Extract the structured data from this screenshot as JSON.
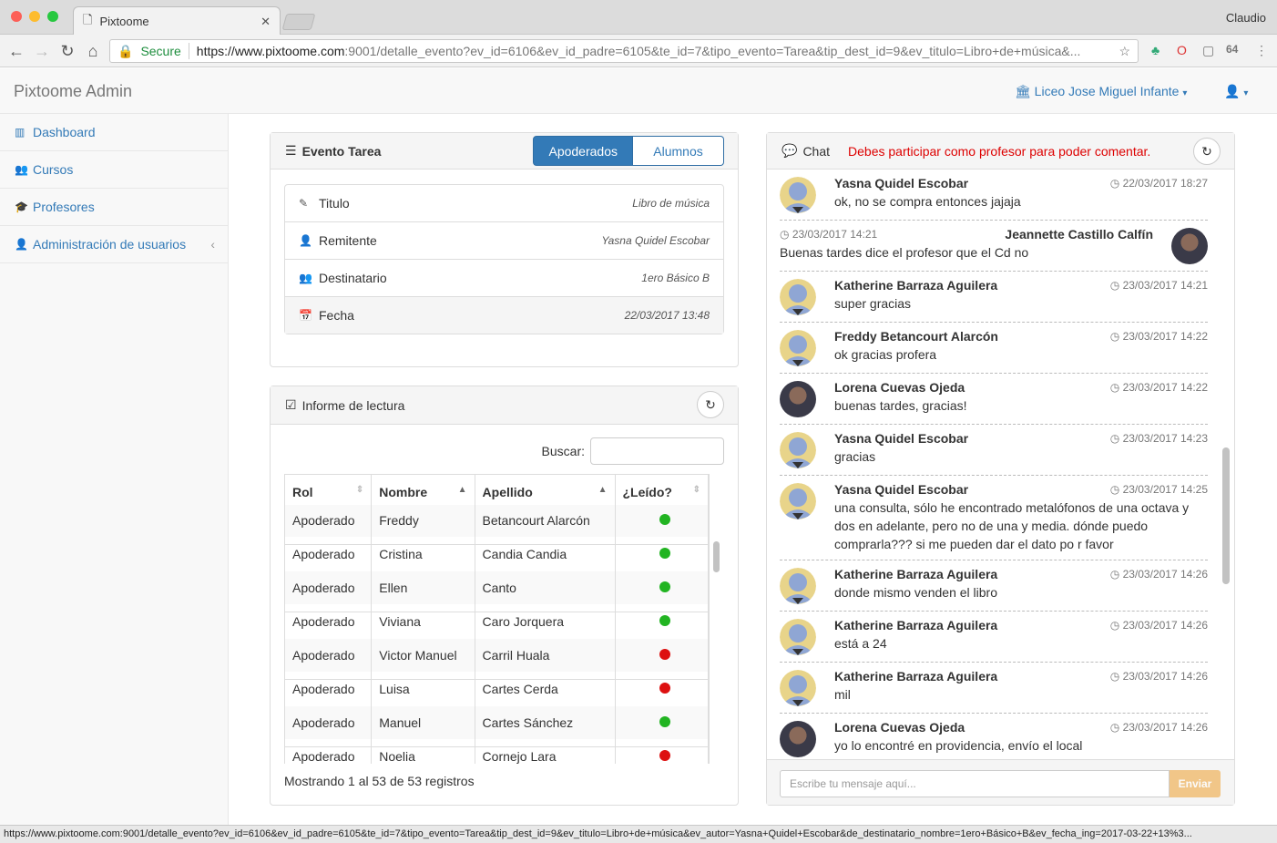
{
  "browser": {
    "tab_title": "Pixtoome",
    "user_name": "Claudio",
    "secure_label": "Secure",
    "url_host": "https://www.pixtoome.com",
    "url_rest": ":9001/detalle_evento?ev_id=6106&ev_id_padre=6105&te_id=7&tipo_evento=Tarea&tip_dest_id=9&ev_titulo=Libro+de+música&...",
    "status_url": "https://www.pixtoome.com:9001/detalle_evento?ev_id=6106&ev_id_padre=6105&te_id=7&tipo_evento=Tarea&tip_dest_id=9&ev_titulo=Libro+de+música&ev_autor=Yasna+Quidel+Escobar&de_destinatario_nombre=1ero+Básico+B&ev_fecha_ing=2017-03-22+13%3..."
  },
  "app": {
    "brand": "Pixtoome Admin",
    "school": "Liceo Jose Miguel Infante"
  },
  "sidebar": {
    "items": [
      {
        "label": "Dashboard",
        "icon": "bar-chart-icon"
      },
      {
        "label": "Cursos",
        "icon": "users-icon"
      },
      {
        "label": "Profesores",
        "icon": "graduation-cap-icon"
      },
      {
        "label": "Administración de usuarios",
        "icon": "user-icon"
      }
    ]
  },
  "event": {
    "title": "Evento Tarea",
    "btn_apoderados": "Apoderados",
    "btn_alumnos": "Alumnos",
    "fields": [
      {
        "label": "Titulo",
        "value": "Libro de música"
      },
      {
        "label": "Remitente",
        "value": "Yasna Quidel Escobar"
      },
      {
        "label": "Destinatario",
        "value": "1ero Básico B"
      },
      {
        "label": "Fecha",
        "value": "22/03/2017 13:48"
      }
    ]
  },
  "report": {
    "title": "Informe de lectura",
    "search_label": "Buscar:",
    "columns": [
      "Rol",
      "Nombre",
      "Apellido",
      "¿Leído?"
    ],
    "rows": [
      {
        "rol": "Apoderado",
        "nombre": "Freddy",
        "apellido": "Betancourt Alarcón",
        "leido": "green"
      },
      {
        "rol": "Apoderado",
        "nombre": "Cristina",
        "apellido": "Candia Candia",
        "leido": "green"
      },
      {
        "rol": "Apoderado",
        "nombre": "Ellen",
        "apellido": "Canto",
        "leido": "green"
      },
      {
        "rol": "Apoderado",
        "nombre": "Viviana",
        "apellido": "Caro Jorquera",
        "leido": "green"
      },
      {
        "rol": "Apoderado",
        "nombre": "Victor Manuel",
        "apellido": "Carril Huala",
        "leido": "red"
      },
      {
        "rol": "Apoderado",
        "nombre": "Luisa",
        "apellido": "Cartes Cerda",
        "leido": "red"
      },
      {
        "rol": "Apoderado",
        "nombre": "Manuel",
        "apellido": "Cartes Sánchez",
        "leido": "green"
      },
      {
        "rol": "Apoderado",
        "nombre": "Noelia",
        "apellido": "Cornejo Lara",
        "leido": "red"
      }
    ],
    "footer": "Mostrando 1 al 53 de 53 registros"
  },
  "chat": {
    "title": "Chat",
    "warning": "Debes participar como profesor para poder comentar.",
    "input_placeholder": "Escribe tu mensaje aquí...",
    "send_label": "Enviar",
    "messages": [
      {
        "name": "Yasna Quidel Escobar",
        "time": "22/03/2017 18:27",
        "text": "ok, no se compra entonces jajaja",
        "side": "left",
        "avatar": "default"
      },
      {
        "name": "Jeannette Castillo Calfín",
        "time": "23/03/2017 14:21",
        "text": "Buenas tardes dice el profesor que el Cd no",
        "side": "right",
        "avatar": "photo"
      },
      {
        "name": "Katherine Barraza Aguilera",
        "time": "23/03/2017 14:21",
        "text": "super gracias",
        "side": "left",
        "avatar": "default"
      },
      {
        "name": "Freddy Betancourt Alarcón",
        "time": "23/03/2017 14:22",
        "text": "ok gracias profera",
        "side": "left",
        "avatar": "default"
      },
      {
        "name": "Lorena Cuevas Ojeda",
        "time": "23/03/2017 14:22",
        "text": "buenas tardes, gracias!",
        "side": "left",
        "avatar": "photo"
      },
      {
        "name": "Yasna Quidel Escobar",
        "time": "23/03/2017 14:23",
        "text": "gracias",
        "side": "left",
        "avatar": "default"
      },
      {
        "name": "Yasna Quidel Escobar",
        "time": "23/03/2017 14:25",
        "text": "una consulta, sólo he encontrado metalófonos de una octava y dos en adelante, pero no de una y media. dónde puedo comprarla??? si me pueden dar el dato po r favor",
        "side": "left",
        "avatar": "default"
      },
      {
        "name": "Katherine Barraza Aguilera",
        "time": "23/03/2017 14:26",
        "text": "donde mismo venden el libro",
        "side": "left",
        "avatar": "default"
      },
      {
        "name": "Katherine Barraza Aguilera",
        "time": "23/03/2017 14:26",
        "text": "está a 24",
        "side": "left",
        "avatar": "default"
      },
      {
        "name": "Katherine Barraza Aguilera",
        "time": "23/03/2017 14:26",
        "text": "mil",
        "side": "left",
        "avatar": "default"
      },
      {
        "name": "Lorena Cuevas Ojeda",
        "time": "23/03/2017 14:26",
        "text": "yo lo encontré en providencia, envío el local",
        "side": "left",
        "avatar": "photo"
      }
    ]
  },
  "colors": {
    "primary": "#337ab7",
    "danger": "#dd0000",
    "read_green": "#22b422",
    "read_red": "#dd1111",
    "avatar_default_bg": "#e8d48a",
    "avatar_default_fg": "#8fa6d4"
  }
}
